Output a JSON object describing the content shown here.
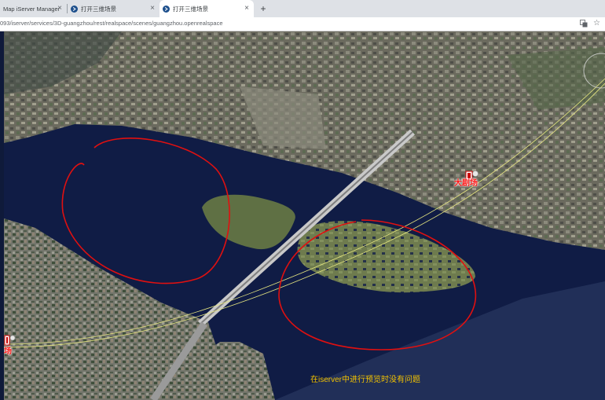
{
  "browser": {
    "tabs": [
      {
        "title": "Map iServer Manager",
        "active": false
      },
      {
        "title": "打开三维场景",
        "active": false
      },
      {
        "title": "打开三维场景",
        "active": true
      }
    ],
    "close_glyph": "×",
    "new_tab_glyph": "+",
    "url": "093/iserver/services/3D-guangzhou/rest/realspace/scenes/guangzhou.openrealspace",
    "star_glyph": "☆"
  },
  "map": {
    "poi_labels": [
      "大剧场",
      "场"
    ],
    "caption": "在iserver中进行预览时没有问题",
    "annotation_color": "#e01010",
    "water_color": "#101c45",
    "label_color": "#ff1a1a",
    "caption_color": "#f2c200"
  }
}
